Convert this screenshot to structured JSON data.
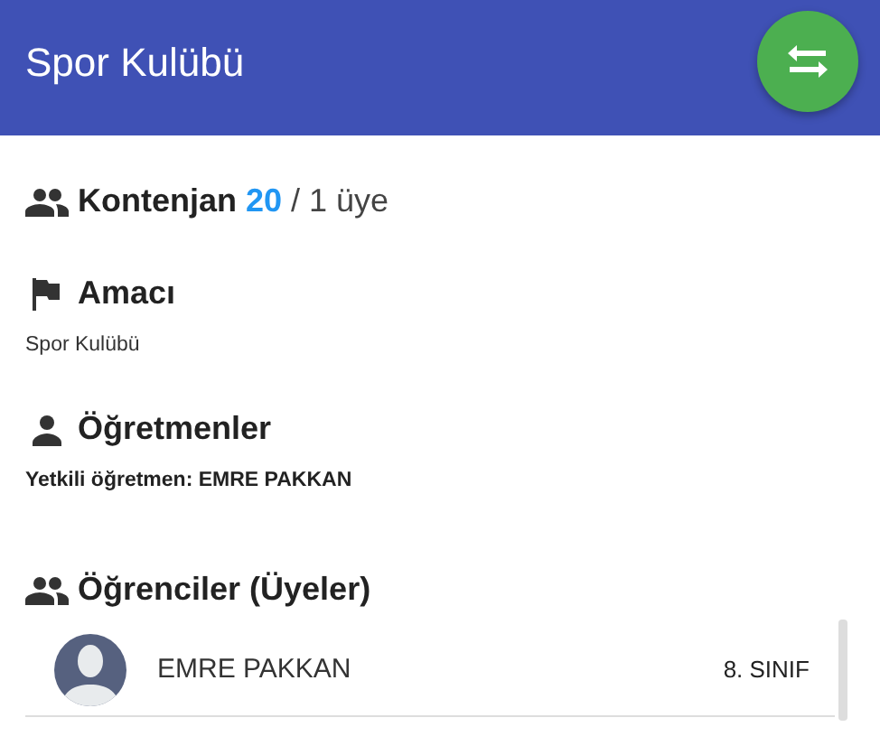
{
  "app_bar": {
    "title": "Spor Kulübü"
  },
  "quota": {
    "label": "Kontenjan",
    "capacity": "20",
    "members": "/ 1 üye"
  },
  "sections": [
    {
      "kind": "flag",
      "title": "Amacı",
      "text": "Spor Kulübü",
      "bold": false
    },
    {
      "kind": "person",
      "title": "Öğretmenler",
      "text": "Yetkili öğretmen: EMRE PAKKAN",
      "bold": true
    }
  ],
  "students": {
    "title": "Öğrenciler (Üyeler)",
    "rows": [
      {
        "name": "EMRE PAKKAN",
        "grade": "8. SINIF"
      }
    ]
  }
}
